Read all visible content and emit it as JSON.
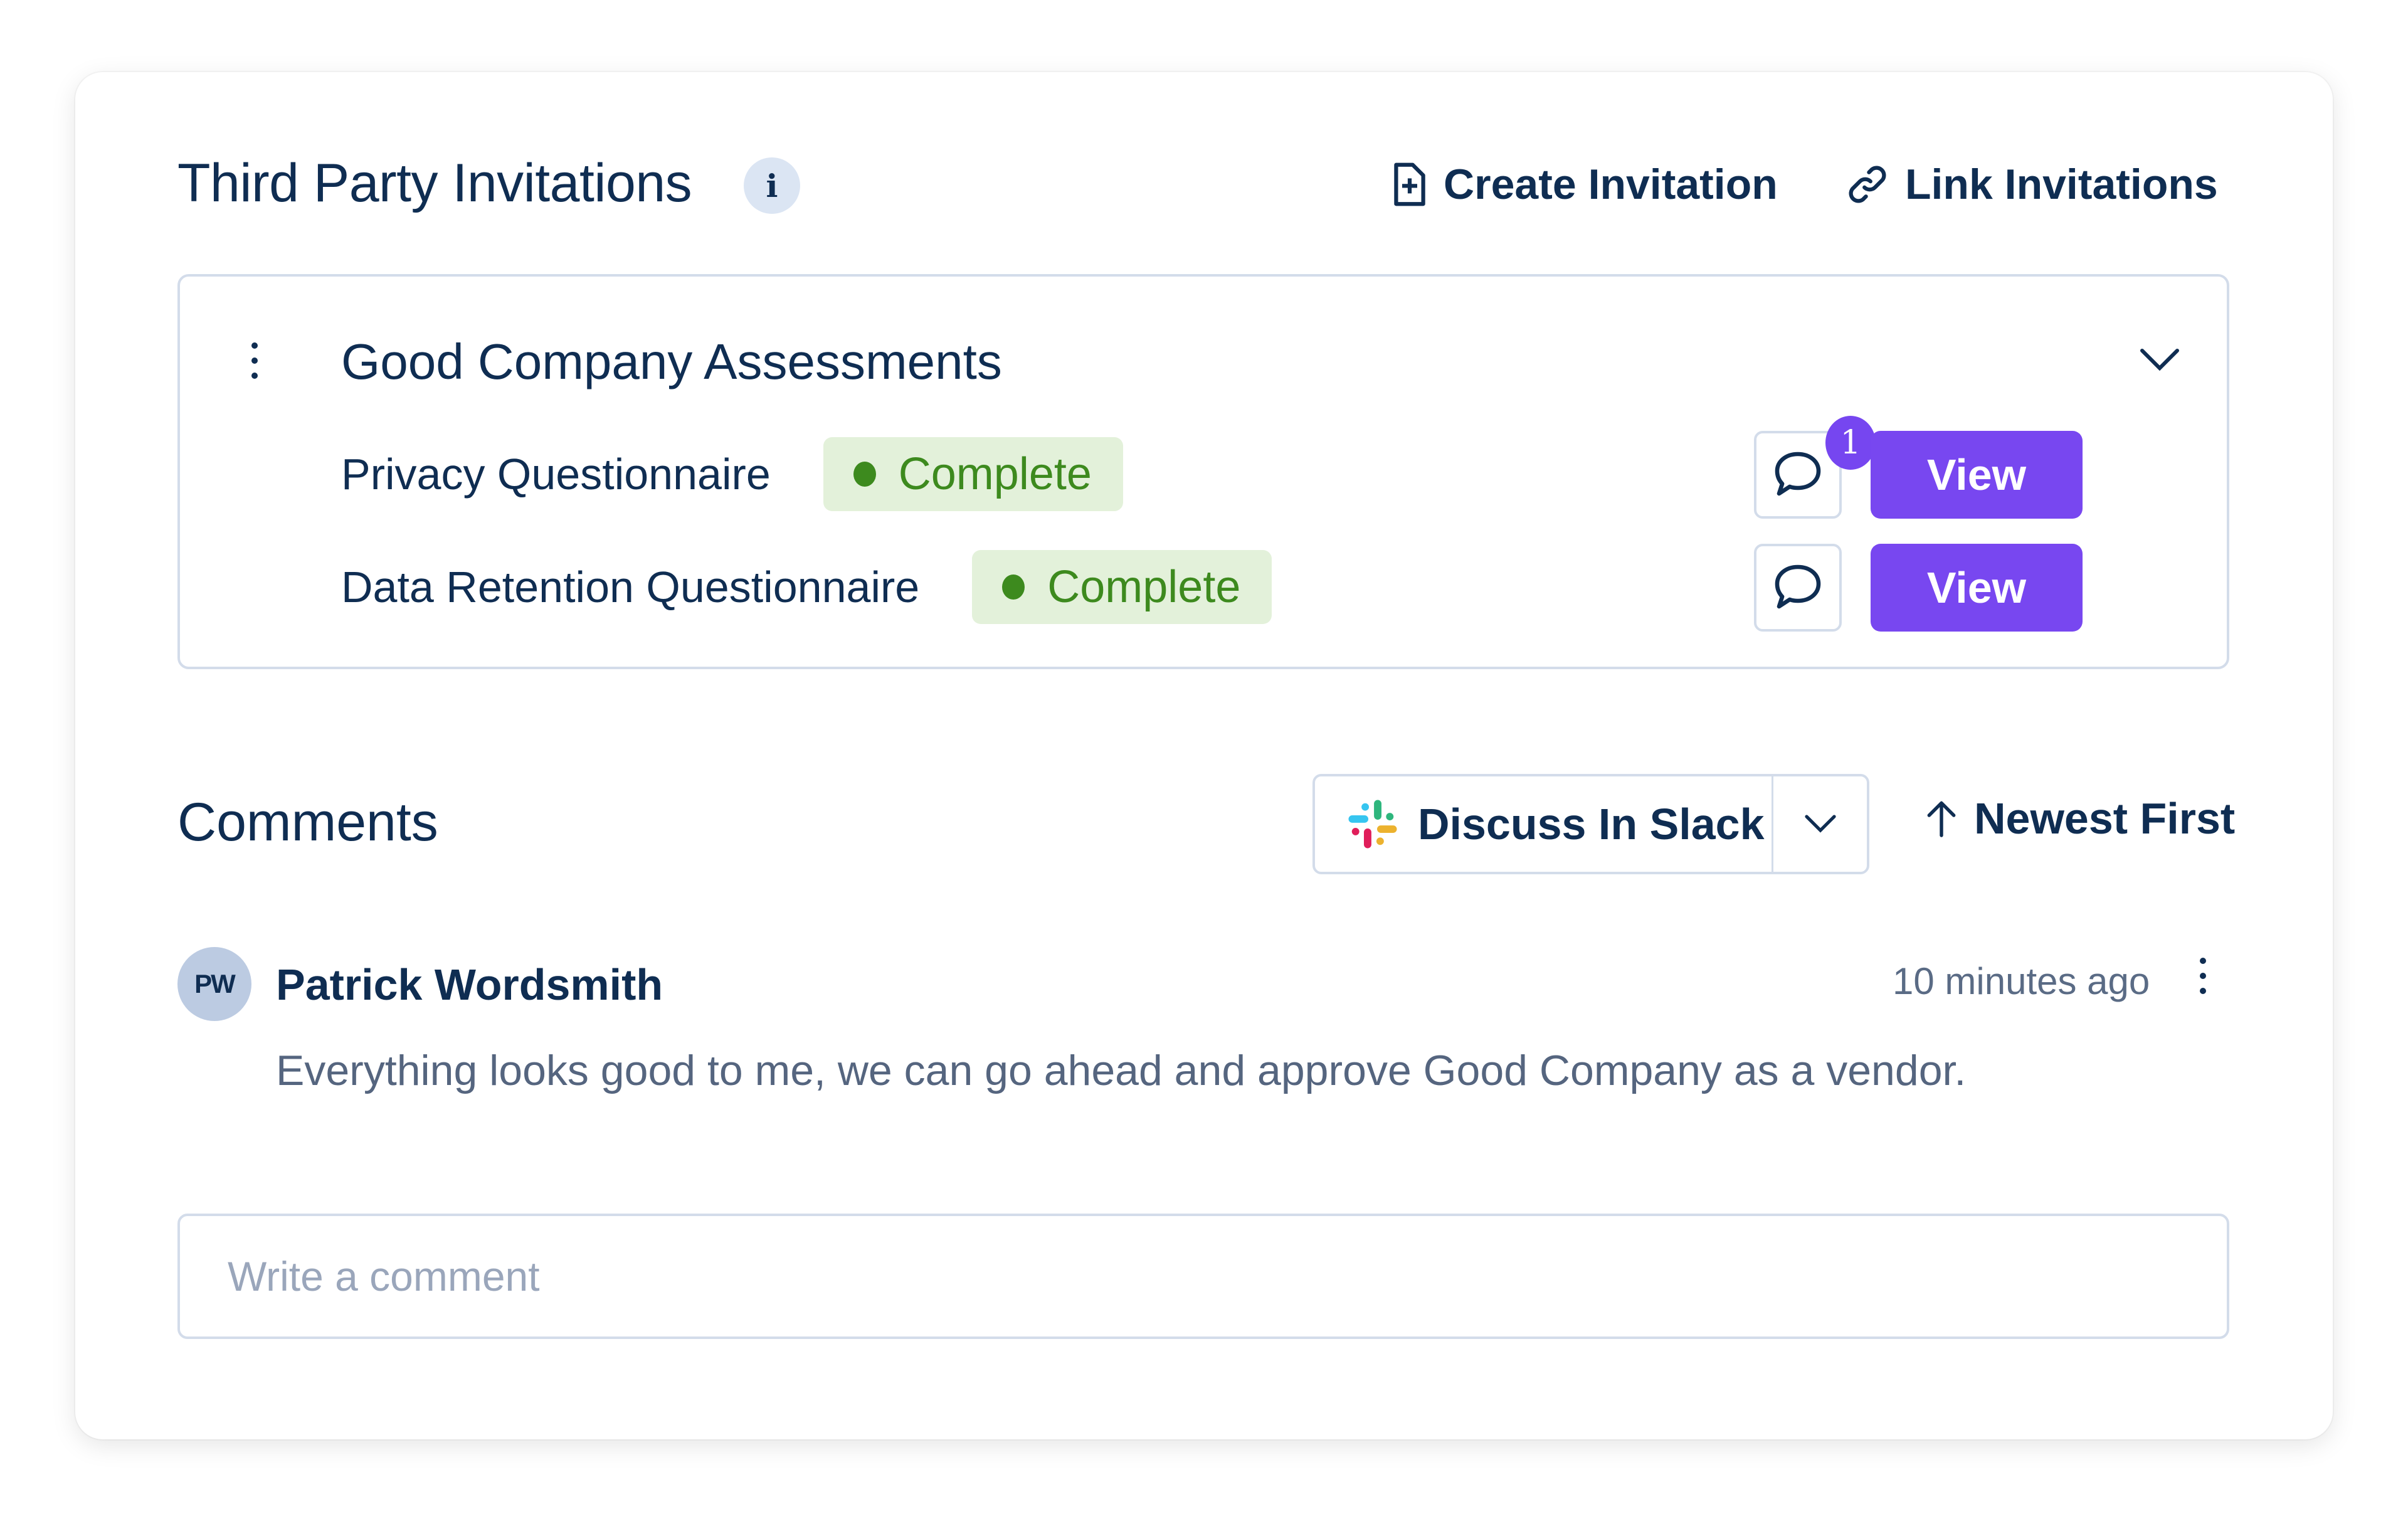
{
  "section": {
    "title": "Third Party Invitations",
    "info_icon": "info-icon",
    "info_glyph": "i",
    "actions": [
      {
        "label": "Create Invitation",
        "icon": "file-plus-icon"
      },
      {
        "label": "Link Invitations",
        "icon": "link-icon"
      }
    ]
  },
  "assessment_group": {
    "title": "Good Company Assessments",
    "menu_icon": "kebab-menu-icon",
    "toggle_icon": "chevron-down-icon",
    "items": [
      {
        "label": "Privacy Questionnaire",
        "status": "Complete",
        "comment_count": "1",
        "view_label": "View"
      },
      {
        "label": "Data Retention Questionnaire",
        "status": "Complete",
        "comment_count": null,
        "view_label": "View"
      }
    ]
  },
  "comments": {
    "title": "Comments",
    "slack_button": {
      "label": "Discuss In Slack",
      "icon": "slack-icon",
      "caret_icon": "chevron-down-icon"
    },
    "sort": {
      "label": "Newest First",
      "icon": "arrow-up-icon"
    },
    "items": [
      {
        "initials": "PW",
        "author": "Patrick Wordsmith",
        "timestamp": "10 minutes ago",
        "text": "Everything looks good to me, we can go ahead and approve Good Company as a vendor."
      }
    ],
    "input": {
      "placeholder": "Write a comment",
      "value": ""
    }
  },
  "colors": {
    "text_primary": "#0f2d52",
    "text_muted": "#55657f",
    "accent_purple": "#7847f0",
    "status_green": "#3d8a1e",
    "status_green_bg": "#e3f1da",
    "border": "#d3dcea",
    "avatar_bg": "#bccbe2",
    "slack_blue": "#36c5f0",
    "slack_green": "#2eb67d",
    "slack_red": "#e01e5a",
    "slack_yellow": "#ecb22e"
  }
}
